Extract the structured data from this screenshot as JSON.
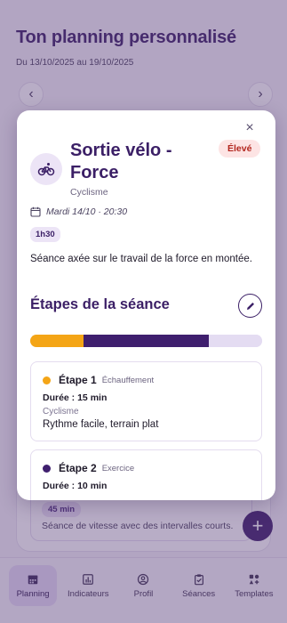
{
  "background": {
    "title": "Ton planning personnalisé",
    "date_range": "Du 13/10/2025 au 19/10/2025",
    "prev_icon": "chevron-left-icon",
    "next_icon": "chevron-right-icon",
    "peek_card": {
      "duration": "45 min",
      "description": "Séance de vitesse avec des intervalles courts."
    },
    "fab_label": "+"
  },
  "bottom_nav": [
    {
      "label": "Planning",
      "icon": "calendar-icon",
      "active": true
    },
    {
      "label": "Indicateurs",
      "icon": "chart-icon",
      "active": false
    },
    {
      "label": "Profil",
      "icon": "profile-icon",
      "active": false
    },
    {
      "label": "Séances",
      "icon": "clipboard-icon",
      "active": false
    },
    {
      "label": "Templates",
      "icon": "templates-icon",
      "active": false
    }
  ],
  "modal": {
    "close_label": "×",
    "title": "Sortie vélo - Force",
    "category": "Cyclisme",
    "priority": "Élevé",
    "datetime": "Mardi 14/10 · 20:30",
    "duration": "1h30",
    "description": "Séance axée sur le travail de la force en montée.",
    "steps_heading": "Étapes de la séance",
    "progress": [
      {
        "name": "Échauffement",
        "fraction": 0.23,
        "color": "#f4a516"
      },
      {
        "name": "Exercice",
        "fraction": 0.54,
        "color": "#3f1f6e"
      },
      {
        "name": "Reste",
        "fraction": 0.23,
        "color": "#e4dcf2"
      }
    ],
    "steps": [
      {
        "name": "Étape 1",
        "type": "Échauffement",
        "duration": "Durée : 15 min",
        "category": "Cyclisme",
        "note": "Rythme facile, terrain plat",
        "color": "#f4a516"
      },
      {
        "name": "Étape 2",
        "type": "Exercice",
        "duration": "Durée : 10 min",
        "category": "",
        "note": "",
        "color": "#3f1f6e"
      }
    ]
  }
}
